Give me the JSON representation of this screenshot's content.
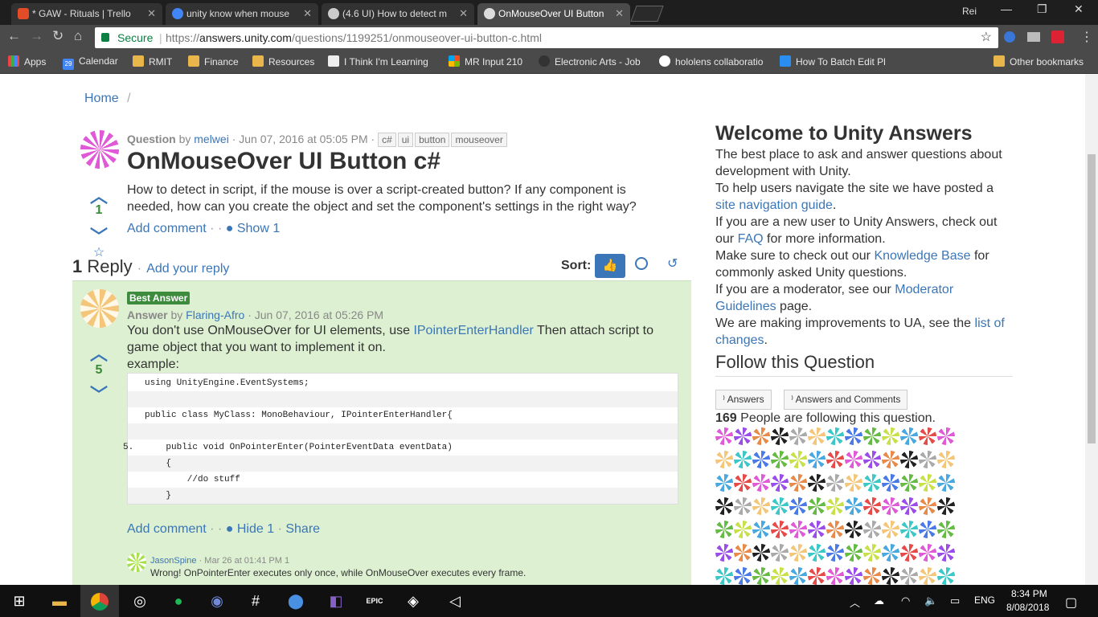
{
  "browser": {
    "tabs": [
      {
        "label": "* GAW - Rituals | Trello",
        "favicon_color": "#e34c26"
      },
      {
        "label": "unity know when mouse",
        "favicon_color": "#4285f4"
      },
      {
        "label": "(4.6 UI) How to detect m",
        "favicon_color": "#222222"
      },
      {
        "label": "OnMouseOver UI Button",
        "favicon_color": "#222222"
      }
    ],
    "profile": "Rei",
    "secure_label": "Secure",
    "url_prefix": "https://",
    "url_host": "answers.unity.com",
    "url_path": "/questions/1199251/onmouseover-ui-button-c.html",
    "bookmarks": [
      "Apps",
      "Calendar",
      "RMIT",
      "Finance",
      "Resources",
      "I Think I'm Learning",
      "MR Input 210",
      "Electronic Arts - Job",
      "hololens collaboratio",
      "How To Batch Edit Pl"
    ],
    "other_bookmarks": "Other bookmarks",
    "calendar_badge": "29"
  },
  "breadcrumb": {
    "home": "Home",
    "sep": "/"
  },
  "question": {
    "label": "Question",
    "by": "by",
    "author": "melwei",
    "date": "· Jun 07, 2016 at 05:05 PM ·",
    "tags": [
      "c#",
      "ui",
      "button",
      "mouseover"
    ],
    "title": "OnMouseOver UI Button c#",
    "body": "How to detect in script, if the mouse is over a script-created button? If any component is needed, how can you create the object and set the component's settings in the right way?",
    "votes": "1",
    "add_comment": "Add comment",
    "show": "Show 1"
  },
  "replies": {
    "count": "1",
    "label": "Reply",
    "add_reply": "Add your reply",
    "sort_label": "Sort:"
  },
  "answer": {
    "badge": "Best Answer",
    "label": "Answer",
    "by": "by",
    "author": "Flaring-Afro",
    "date": "· Jun 07, 2016 at 05:26 PM",
    "body_before": "You don't use OnMouseOver for UI elements, use ",
    "body_link": "IPointerEnterHandler",
    "body_after": " Then attach script to game object that you want to implement it on.",
    "example": "example:",
    "votes": "5",
    "code_lines": [
      "using UnityEngine.EventSystems;",
      "",
      "public class MyClass: MonoBehaviour, IPointerEnterHandler{",
      "",
      "    public void OnPointerEnter(PointerEventData eventData)",
      "    {",
      "        //do stuff",
      "    }"
    ],
    "line_number": "5.",
    "add_comment": "Add comment",
    "hide": "Hide 1",
    "share": "Share"
  },
  "comment": {
    "author": "JasonSpine",
    "date": "· Mar 26 at 01:41 PM",
    "count": "1",
    "text": "Wrong! OnPointerEnter executes only once, while OnMouseOver executes every frame."
  },
  "sidebar": {
    "welcome_title": "Welcome to Unity Answers",
    "p1": "The best place to ask and answer questions about development with Unity.",
    "p2_before": "To help users navigate the site we have posted a ",
    "p2_link": "site navigation guide",
    "p2_after": ".",
    "p3_before": "If you are a new user to Unity Answers, check out our ",
    "p3_link": "FAQ",
    "p3_after": " for more information.",
    "p4_before": "Make sure to check out our ",
    "p4_link": "Knowledge Base",
    "p4_after": " for commonly asked Unity questions.",
    "p5_before": "If you are a moderator, see our ",
    "p5_link": "Moderator Guidelines",
    "p5_after": " page.",
    "p6_before": "We are making improvements to UA, see the ",
    "p6_link": "list of changes",
    "p6_after": ".",
    "follow_title": "Follow this Question",
    "btn_answers": "Answers",
    "btn_answers_comments": "Answers and Comments",
    "followers_count": "169",
    "followers_text": "People are following this question."
  },
  "taskbar": {
    "lang": "ENG",
    "time": "8:34 PM",
    "date": "8/08/2018",
    "epic": "EPIC"
  },
  "colors": {
    "answer_bg": "#ddf0d2",
    "best_badge": "#3d8b3d",
    "link": "#3a76b8",
    "sort_active": "#3a76b8"
  }
}
